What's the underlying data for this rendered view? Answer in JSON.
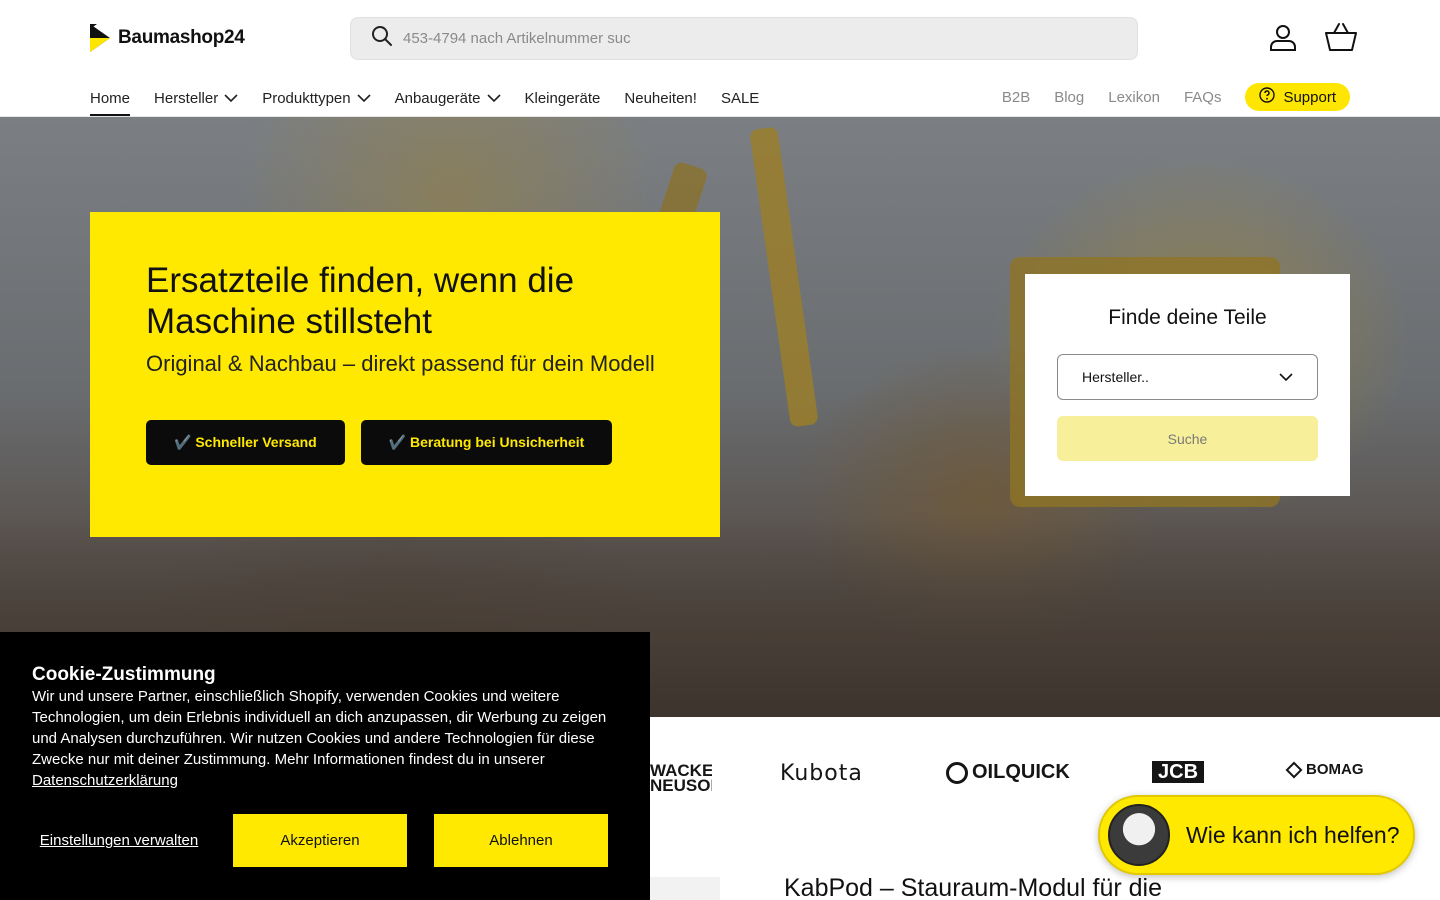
{
  "header": {
    "logo_text": "Baumashop24",
    "search_placeholder": "453-4794 nach Artikelnummer suc",
    "icons": {
      "account": "user-icon",
      "cart": "basket-icon",
      "search": "search-icon"
    }
  },
  "nav": {
    "items": [
      {
        "label": "Home",
        "dropdown": false,
        "active": true
      },
      {
        "label": "Hersteller",
        "dropdown": true
      },
      {
        "label": "Produkttypen",
        "dropdown": true
      },
      {
        "label": "Anbaugeräte",
        "dropdown": true
      },
      {
        "label": "Kleingeräte",
        "dropdown": false
      },
      {
        "label": "Neuheiten!",
        "dropdown": false
      },
      {
        "label": "SALE",
        "dropdown": false
      }
    ],
    "right_links": [
      "B2B",
      "Blog",
      "Lexikon",
      "FAQs"
    ],
    "support_label": "Support"
  },
  "hero": {
    "title": "Ersatzteile finden, wenn die Maschine stillsteht",
    "subtitle": "Original & Nachbau – direkt passend für dein Modell",
    "buttons": [
      "✔️ Schneller Versand",
      "✔️ Beratung bei Unsicherheit"
    ]
  },
  "finder": {
    "title": "Finde deine Teile",
    "select_value": "Hersteller..",
    "button_label": "Suche"
  },
  "brands": [
    "WACKER NEUSON",
    "Kubota",
    "OILQUICK",
    "JCB",
    "BOMAG"
  ],
  "teaser": {
    "title": "KabPod – Stauraum-Modul für die"
  },
  "cookie": {
    "title": "Cookie-Zustimmung",
    "text": "Wir und unsere Partner, einschließlich Shopify, verwenden Cookies und weitere Technologien, um dein Erlebnis individuell an dich anzupassen, dir Werbung zu zeigen und Analysen durchzuführen. Wir nutzen Cookies und andere Technologien für diese Zwecke nur mit deiner Zustimmung. Mehr Informationen findest du in unserer",
    "link": "Datenschutzerklärung",
    "manage_label": "Einstellungen verwalten",
    "accept_label": "Akzeptieren",
    "decline_label": "Ablehnen"
  },
  "chat": {
    "label": "Wie kann ich helfen?"
  },
  "colors": {
    "brand_yellow": "#ffe900",
    "black": "#0b0b0b"
  }
}
